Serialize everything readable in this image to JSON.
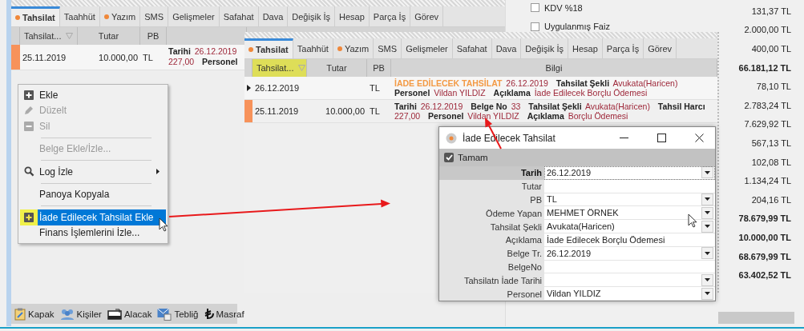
{
  "back_window": {
    "tabs": [
      {
        "label": "Tahsilat",
        "selected": true,
        "dot": true
      },
      {
        "label": "Taahhüt",
        "selected": false,
        "dot": false
      },
      {
        "label": "Yazım",
        "selected": false,
        "dot": true
      },
      {
        "label": "SMS",
        "selected": false,
        "dot": false
      },
      {
        "label": "Gelişmeler",
        "selected": false,
        "dot": false
      },
      {
        "label": "Safahat",
        "selected": false,
        "dot": false
      },
      {
        "label": "Dava",
        "selected": false,
        "dot": false
      },
      {
        "label": "Değişik İş",
        "selected": false,
        "dot": false
      },
      {
        "label": "Hesap",
        "selected": false,
        "dot": false
      },
      {
        "label": "Parça İş",
        "selected": false,
        "dot": false
      },
      {
        "label": "Görev",
        "selected": false,
        "dot": false
      }
    ],
    "columns": [
      {
        "label": "Tahsilat...",
        "filter": true,
        "highlighted": false
      },
      {
        "label": "Tutar",
        "filter": false,
        "highlighted": false
      },
      {
        "label": "PB",
        "filter": false,
        "highlighted": false
      }
    ],
    "rows": [
      {
        "current": false,
        "flagged": true,
        "date": "25.11.2019",
        "amount": "10.000,00",
        "currency": "TL",
        "info": [
          {
            "kind": "label",
            "text": "Tarihi"
          },
          {
            "kind": "value",
            "text": "26.12.2019"
          },
          {
            "kind": "value",
            "text": "227,00"
          },
          {
            "kind": "label",
            "text": "Personel"
          }
        ]
      }
    ],
    "toolbar": [
      {
        "label": "Kapak"
      },
      {
        "label": "Kişiler"
      },
      {
        "label": "Alacak"
      },
      {
        "label": "Tebliğ"
      },
      {
        "label": "Masraf"
      }
    ]
  },
  "right_panel": {
    "rows": [
      {
        "label": "KDV %18",
        "value": "131,37 TL",
        "bold": false
      },
      {
        "label": "Uygulanmış Faiz",
        "value": "2.000,00 TL",
        "bold": false
      },
      {
        "value": "400,00 TL",
        "bold": false
      },
      {
        "value": "66.181,12 TL",
        "bold": true
      },
      {
        "value": "78,10 TL",
        "bold": false
      },
      {
        "value": "2.783,24 TL",
        "bold": false
      },
      {
        "value": "7.629,92 TL",
        "bold": false
      },
      {
        "value": "567,13 TL",
        "bold": false
      },
      {
        "value": "102,08 TL",
        "bold": false
      },
      {
        "value": "1.134,24 TL",
        "bold": false
      },
      {
        "value": "204,16 TL",
        "bold": false
      },
      {
        "value": "78.679,99 TL",
        "bold": true
      },
      {
        "value": "10.000,00 TL",
        "bold": true
      },
      {
        "value": "68.679,99 TL",
        "bold": true
      },
      {
        "value": "63.402,52 TL",
        "bold": true
      }
    ]
  },
  "front_window": {
    "tabs": [
      {
        "label": "Tahsilat",
        "selected": true,
        "dot": true
      },
      {
        "label": "Taahhüt",
        "selected": false,
        "dot": false
      },
      {
        "label": "Yazım",
        "selected": false,
        "dot": true
      },
      {
        "label": "SMS",
        "selected": false,
        "dot": false
      },
      {
        "label": "Gelişmeler",
        "selected": false,
        "dot": false
      },
      {
        "label": "Safahat",
        "selected": false,
        "dot": false
      },
      {
        "label": "Dava",
        "selected": false,
        "dot": false
      },
      {
        "label": "Değişik İş",
        "selected": false,
        "dot": false
      },
      {
        "label": "Hesap",
        "selected": false,
        "dot": false
      },
      {
        "label": "Parça İş",
        "selected": false,
        "dot": false
      },
      {
        "label": "Görev",
        "selected": false,
        "dot": false
      }
    ],
    "columns": [
      {
        "label": "Tahsilat...",
        "filter": true,
        "highlighted": true
      },
      {
        "label": "Tutar",
        "filter": false,
        "highlighted": false
      },
      {
        "label": "PB",
        "filter": false,
        "highlighted": false
      },
      {
        "label": "Bilgi",
        "filter": false,
        "highlighted": false
      }
    ],
    "rows": [
      {
        "current": true,
        "flagged": false,
        "date": "26.12.2019",
        "currency": "TL",
        "info": [
          {
            "kind": "title",
            "text": "İADE EDİLECEK TAHSİLAT"
          },
          {
            "kind": "value",
            "text": "26.12.2019"
          },
          {
            "kind": "label",
            "text": "Tahsilat Şekli"
          },
          {
            "kind": "value",
            "text": "Avukata(Haricen)"
          },
          {
            "kind": "label",
            "text": "Personel"
          },
          {
            "kind": "value",
            "text": "Vildan YILDIZ"
          },
          {
            "kind": "label",
            "text": "Açıklama"
          },
          {
            "kind": "value",
            "text": "İade Edilecek Borçlu Ödemesi"
          }
        ]
      },
      {
        "current": false,
        "flagged": true,
        "date": "25.11.2019",
        "amount": "10.000,00",
        "currency": "TL",
        "info": [
          {
            "kind": "label",
            "text": "Tarihi"
          },
          {
            "kind": "value",
            "text": "26.12.2019"
          },
          {
            "kind": "label",
            "text": "Belge No"
          },
          {
            "kind": "value",
            "text": "33"
          },
          {
            "kind": "label",
            "text": "Tahsilat Şekli"
          },
          {
            "kind": "value",
            "text": "Avukata(Haricen)"
          },
          {
            "kind": "label",
            "text": "Tahsil Harcı"
          },
          {
            "kind": "value",
            "text": "227,00"
          },
          {
            "kind": "label",
            "text": "Personel"
          },
          {
            "kind": "value",
            "text": "Vildan YILDIZ"
          },
          {
            "kind": "label",
            "text": "Açıklama"
          },
          {
            "kind": "value",
            "text": "Borçlu Ödemesi"
          }
        ]
      }
    ]
  },
  "context_menu": {
    "items": [
      {
        "kind": "item",
        "label": "Ekle",
        "disabled": false,
        "selected": false,
        "highlighted": false,
        "submenu": false
      },
      {
        "kind": "item",
        "label": "Düzelt",
        "disabled": true,
        "selected": false,
        "highlighted": false,
        "submenu": false
      },
      {
        "kind": "item",
        "label": "Sil",
        "disabled": true,
        "selected": false,
        "highlighted": false,
        "submenu": false
      },
      {
        "kind": "separator"
      },
      {
        "kind": "item",
        "label": "Belge Ekle/İzle...",
        "disabled": true,
        "selected": false,
        "highlighted": false,
        "submenu": false
      },
      {
        "kind": "separator"
      },
      {
        "kind": "item",
        "label": "Log İzle",
        "disabled": false,
        "selected": false,
        "highlighted": false,
        "submenu": true
      },
      {
        "kind": "separator"
      },
      {
        "kind": "item",
        "label": "Panoya Kopyala",
        "disabled": false,
        "selected": false,
        "highlighted": false,
        "submenu": false
      },
      {
        "kind": "separator"
      },
      {
        "kind": "item",
        "label": "İade Edilecek Tahsilat Ekle",
        "disabled": false,
        "selected": true,
        "highlighted": true,
        "submenu": false
      },
      {
        "kind": "item",
        "label": "Finans İşlemlerini İzle...",
        "disabled": false,
        "selected": false,
        "highlighted": false,
        "submenu": false
      }
    ]
  },
  "dialog": {
    "title": "İade Edilecek Tahsilat",
    "ok_button": "Tamam",
    "fields": [
      {
        "label": "Tarih",
        "value": "26.12.2019",
        "dropdown": true,
        "focused": true
      },
      {
        "label": "Tutar",
        "dropdown": false,
        "focused": false
      },
      {
        "label": "PB",
        "value": "TL",
        "dropdown": true,
        "focused": false
      },
      {
        "label": "Ödeme Yapan",
        "value": "MEHMET ÖRNEK",
        "dropdown": true,
        "focused": false
      },
      {
        "label": "Tahsilat Şekli",
        "value": "Avukata(Haricen)",
        "dropdown": true,
        "focused": false
      },
      {
        "label": "Açıklama",
        "value": "İade Edilecek Borçlu Ödemesi",
        "dropdown": false,
        "focused": false
      },
      {
        "label": "Belge Tr.",
        "value": "26.12.2019",
        "dropdown": true,
        "focused": false
      },
      {
        "label": "BelgeNo",
        "dropdown": false,
        "focused": false
      },
      {
        "label": "Tahsilatn İade Tarihi",
        "dropdown": true,
        "focused": false
      },
      {
        "label": "Personel",
        "value": "Vildan YILDIZ",
        "dropdown": true,
        "focused": false
      }
    ]
  }
}
